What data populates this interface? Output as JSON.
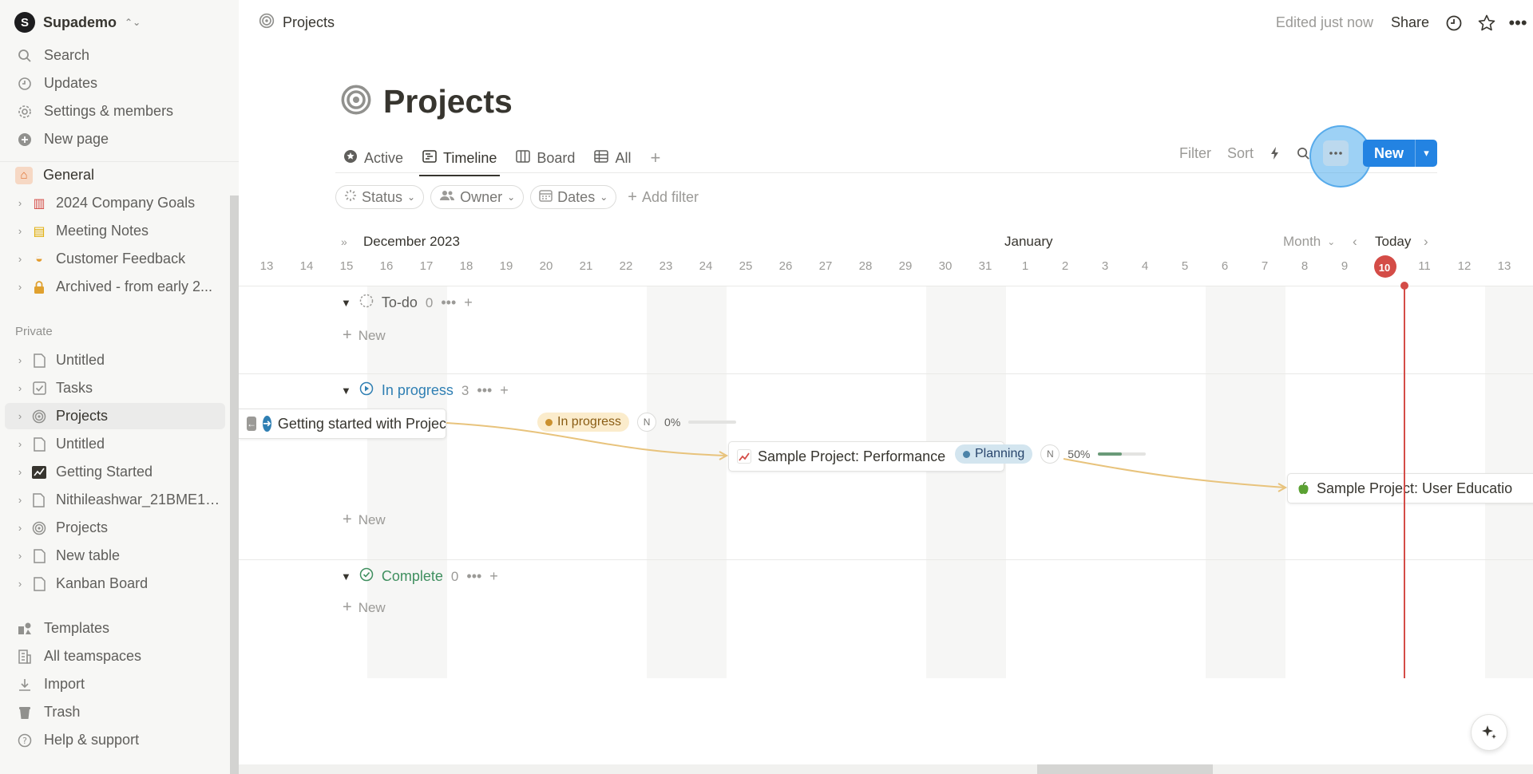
{
  "workspace": {
    "name": "Supademo",
    "logo_letter": "S"
  },
  "sidebar": {
    "top": [
      {
        "label": "Search",
        "icon": "search-icon"
      },
      {
        "label": "Updates",
        "icon": "clock-icon"
      },
      {
        "label": "Settings & members",
        "icon": "gear-icon"
      },
      {
        "label": "New page",
        "icon": "plus-circle-icon"
      }
    ],
    "teamspace": [
      {
        "label": "General",
        "icon": "home-icon"
      },
      {
        "label": "2024 Company Goals",
        "icon": "book-icon"
      },
      {
        "label": "Meeting Notes",
        "icon": "notebook-icon"
      },
      {
        "label": "Customer Feedback",
        "icon": "bowl-icon"
      },
      {
        "label": "Archived - from early 2...",
        "icon": "lock-icon"
      }
    ],
    "private_label": "Private",
    "private": [
      {
        "label": "Untitled",
        "icon": "page-icon"
      },
      {
        "label": "Tasks",
        "icon": "checkbox-icon"
      },
      {
        "label": "Projects",
        "icon": "target-icon"
      },
      {
        "label": "Untitled",
        "icon": "page-icon"
      },
      {
        "label": "Getting Started",
        "icon": "chart-icon"
      },
      {
        "label": "Nithileashwar_21BME10...",
        "icon": "page-icon"
      },
      {
        "label": "Projects",
        "icon": "target-icon"
      },
      {
        "label": "New table",
        "icon": "page-icon"
      },
      {
        "label": "Kanban Board",
        "icon": "page-icon"
      }
    ],
    "bottom": [
      {
        "label": "Templates",
        "icon": "templates-icon"
      },
      {
        "label": "All teamspaces",
        "icon": "building-icon"
      },
      {
        "label": "Import",
        "icon": "download-icon"
      },
      {
        "label": "Trash",
        "icon": "trash-icon"
      },
      {
        "label": "Help & support",
        "icon": "help-icon"
      }
    ]
  },
  "topbar": {
    "breadcrumb": "Projects",
    "edited": "Edited just now",
    "share": "Share"
  },
  "page": {
    "title": "Projects"
  },
  "tabs": [
    {
      "label": "Active",
      "icon": "star-badge-icon"
    },
    {
      "label": "Timeline",
      "icon": "timeline-icon"
    },
    {
      "label": "Board",
      "icon": "board-icon"
    },
    {
      "label": "All",
      "icon": "table-icon"
    }
  ],
  "actions": {
    "filter": "Filter",
    "sort": "Sort",
    "new": "New"
  },
  "filters": [
    {
      "label": "Status",
      "icon": "status-icon"
    },
    {
      "label": "Owner",
      "icon": "people-icon"
    },
    {
      "label": "Dates",
      "icon": "calendar-icon"
    }
  ],
  "add_filter": "Add filter",
  "timeline": {
    "month_left": "December 2023",
    "month_mid": "January",
    "scale": "Month",
    "today": "Today",
    "days": [
      "13",
      "14",
      "15",
      "16",
      "17",
      "18",
      "19",
      "20",
      "21",
      "22",
      "23",
      "24",
      "25",
      "26",
      "27",
      "28",
      "29",
      "30",
      "31",
      "1",
      "2",
      "3",
      "4",
      "5",
      "6",
      "7",
      "8",
      "9",
      "10",
      "11",
      "12",
      "13"
    ],
    "today_day": "10"
  },
  "groups": [
    {
      "label": "To-do",
      "count": "0",
      "color": "#787774"
    },
    {
      "label": "In progress",
      "count": "3",
      "color": "#2f7fb3"
    },
    {
      "label": "Complete",
      "count": "0",
      "color": "#3f8f5f"
    }
  ],
  "new_label": "New",
  "cards": [
    {
      "title": "Getting started with Projects & Tasks",
      "status": "In progress",
      "status_bg": "#fbeccc",
      "status_dot": "#cb912f",
      "owner": "N",
      "progress_text": "0%",
      "progress": 0
    },
    {
      "title": "Sample Project: Performance",
      "status": "Planning",
      "status_bg": "#d3e5ef",
      "status_dot": "#4c83a8",
      "owner": "N",
      "progress_text": "50%",
      "progress": 0.5
    },
    {
      "title": "Sample Project: User Educatio"
    }
  ],
  "colors": {
    "accent": "#2383e2",
    "today": "#d44c47"
  }
}
